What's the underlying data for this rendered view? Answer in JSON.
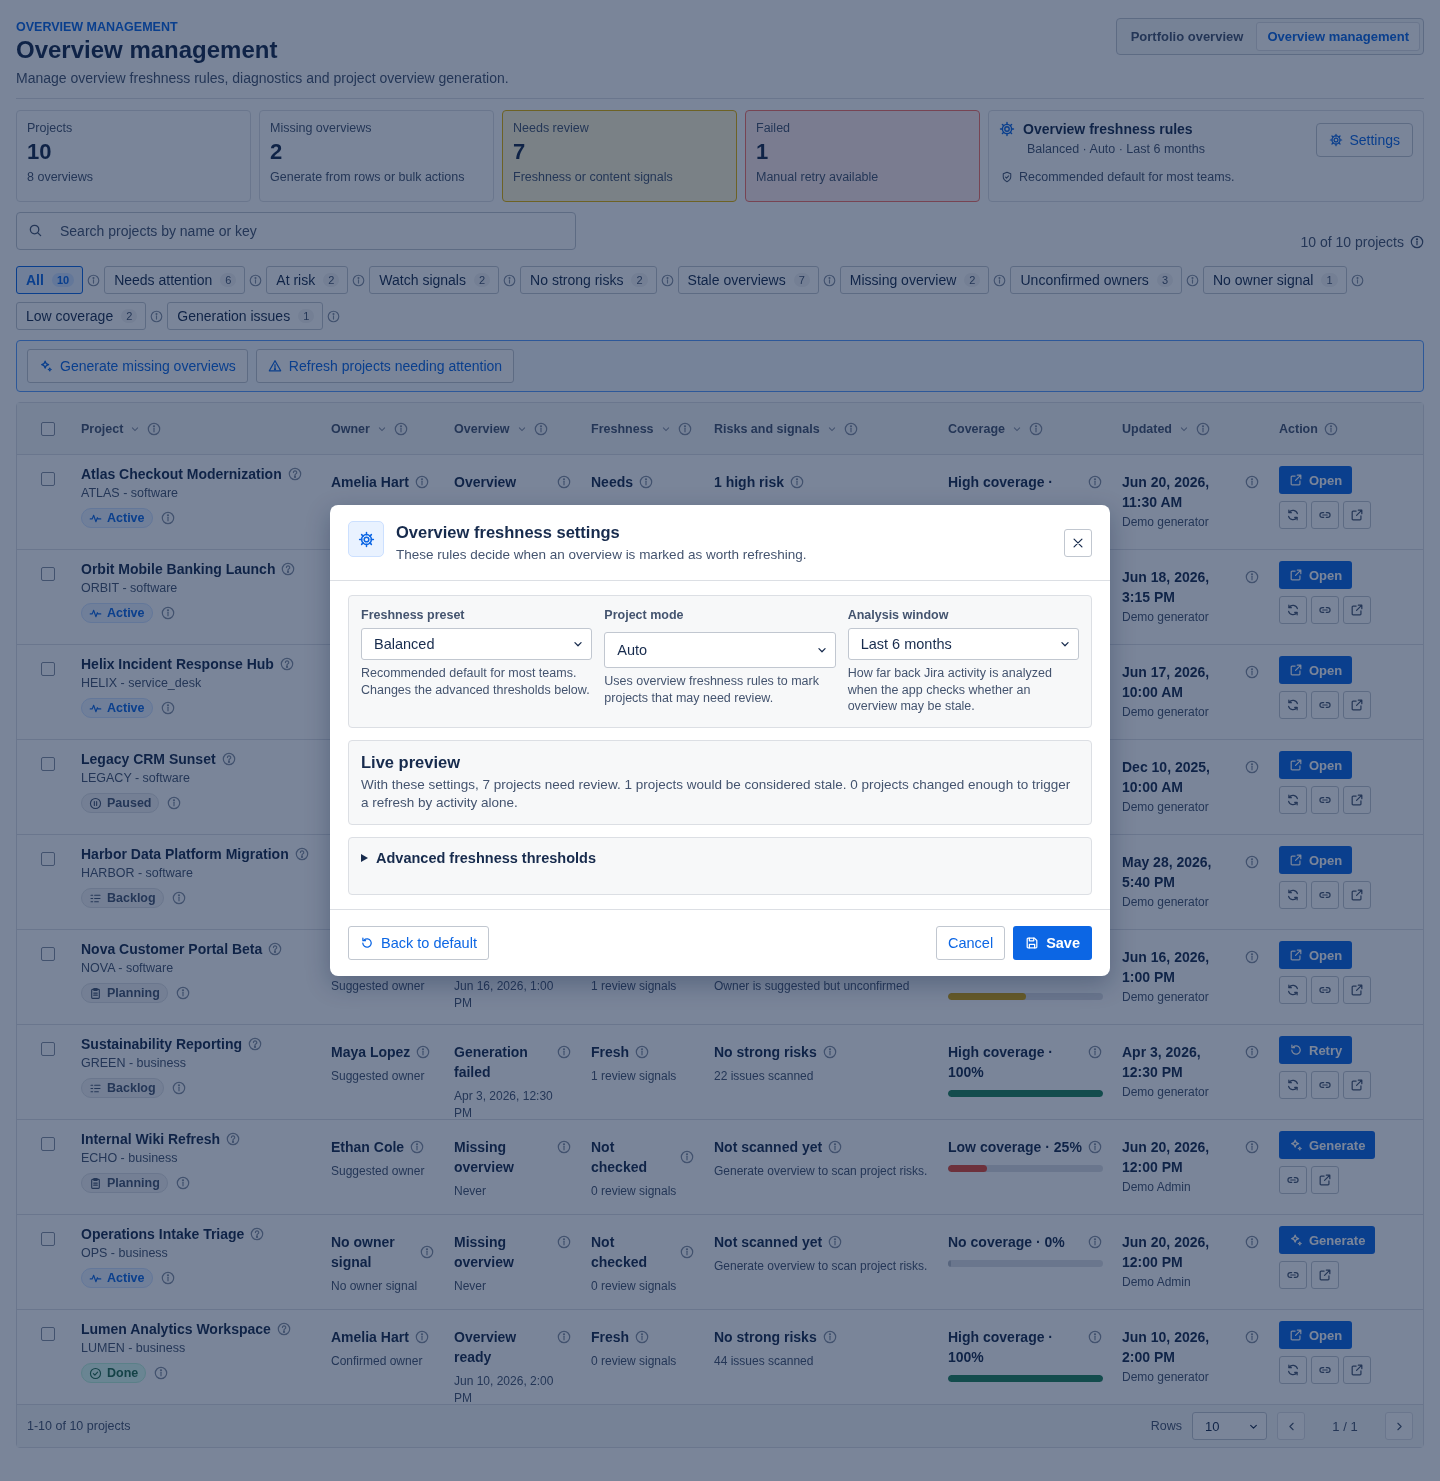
{
  "header": {
    "eyebrow": "OVERVIEW MANAGEMENT",
    "title": "Overview management",
    "subtitle": "Manage overview freshness rules, diagnostics and project overview generation."
  },
  "view_switch": [
    {
      "label": "Portfolio overview",
      "selected": false
    },
    {
      "label": "Overview management",
      "selected": true
    }
  ],
  "stats": [
    {
      "label": "Projects",
      "value": "10",
      "note": "8 overviews",
      "kind": "neutral"
    },
    {
      "label": "Missing overviews",
      "value": "2",
      "note": "Generate from rows or bulk actions",
      "kind": "neutral"
    },
    {
      "label": "Needs review",
      "value": "7",
      "note": "Freshness or content signals",
      "kind": "warning"
    },
    {
      "label": "Failed",
      "value": "1",
      "note": "Manual retry available",
      "kind": "danger"
    }
  ],
  "rules_card": {
    "title": "Overview freshness rules",
    "summary": "Balanced · Auto · Last 6 months",
    "note": "Recommended default for most teams.",
    "button": "Settings"
  },
  "search": {
    "placeholder": "Search projects by name or key"
  },
  "result_count": "10 of 10 projects",
  "filters": [
    {
      "label": "All",
      "count": "10",
      "selected": true
    },
    {
      "label": "Needs attention",
      "count": "6",
      "selected": false
    },
    {
      "label": "At risk",
      "count": "2",
      "selected": false
    },
    {
      "label": "Watch signals",
      "count": "2",
      "selected": false
    },
    {
      "label": "No strong risks",
      "count": "2",
      "selected": false
    },
    {
      "label": "Stale overviews",
      "count": "7",
      "selected": false
    },
    {
      "label": "Missing overview",
      "count": "2",
      "selected": false
    },
    {
      "label": "Unconfirmed owners",
      "count": "3",
      "selected": false
    },
    {
      "label": "No owner signal",
      "count": "1",
      "selected": false
    },
    {
      "label": "Low coverage",
      "count": "2",
      "selected": false
    },
    {
      "label": "Generation issues",
      "count": "1",
      "selected": false
    }
  ],
  "bulk_actions": [
    {
      "kind": "generate",
      "label": "Generate missing overviews"
    },
    {
      "kind": "refresh",
      "label": "Refresh projects needing attention"
    }
  ],
  "table": {
    "select_all": false,
    "columns": [
      {
        "label": "Project",
        "sortable": true
      },
      {
        "label": "Owner",
        "sortable": true
      },
      {
        "label": "Overview",
        "sortable": true
      },
      {
        "label": "Freshness",
        "sortable": true
      },
      {
        "label": "Risks and signals",
        "sortable": true
      },
      {
        "label": "Coverage",
        "sortable": true
      },
      {
        "label": "Updated",
        "sortable": true
      },
      {
        "label": "Action",
        "sortable": false
      }
    ],
    "rows": [
      {
        "selected": false,
        "name": "Atlas Checkout Modernization",
        "key": "ATLAS - software",
        "status": {
          "kind": "active",
          "label": "Active"
        },
        "owner": {
          "title": "Amelia Hart"
        },
        "overview": {
          "title": "Overview"
        },
        "freshness": {
          "title": "Needs"
        },
        "risk": {
          "title": "1 high risk"
        },
        "coverage": {
          "label": "High coverage ·"
        },
        "updated": {
          "date": "Jun 20, 2026, 11:30 AM",
          "by": "Demo generator"
        },
        "action": {
          "kind": "open",
          "label": "Open"
        },
        "tools": [
          {
            "kind": "refresh"
          },
          {
            "kind": "link"
          },
          {
            "kind": "external"
          }
        ]
      },
      {
        "selected": false,
        "name": "Orbit Mobile Banking Launch",
        "key": "ORBIT - software",
        "status": {
          "kind": "active",
          "label": "Active"
        },
        "owner": {},
        "overview": {},
        "freshness": {},
        "risk": {},
        "coverage": {},
        "updated": {
          "date": "Jun 18, 2026, 3:15 PM",
          "by": "Demo generator"
        },
        "action": {
          "kind": "open",
          "label": "Open"
        },
        "tools": [
          {
            "kind": "refresh"
          },
          {
            "kind": "link"
          },
          {
            "kind": "external"
          }
        ]
      },
      {
        "selected": false,
        "name": "Helix Incident Response Hub",
        "key": "HELIX - service_desk",
        "status": {
          "kind": "active",
          "label": "Active"
        },
        "owner": {},
        "overview": {},
        "freshness": {},
        "risk": {},
        "coverage": {},
        "updated": {
          "date": "Jun 17, 2026, 10:00 AM",
          "by": "Demo generator"
        },
        "action": {
          "kind": "open",
          "label": "Open"
        },
        "tools": [
          {
            "kind": "refresh"
          },
          {
            "kind": "link"
          },
          {
            "kind": "external"
          }
        ]
      },
      {
        "selected": false,
        "name": "Legacy CRM Sunset",
        "key": "LEGACY - software",
        "status": {
          "kind": "paused",
          "label": "Paused"
        },
        "owner": {},
        "overview": {},
        "freshness": {},
        "risk": {},
        "coverage": {},
        "updated": {
          "date": "Dec 10, 2025, 10:00 AM",
          "by": "Demo generator"
        },
        "action": {
          "kind": "open",
          "label": "Open"
        },
        "tools": [
          {
            "kind": "refresh"
          },
          {
            "kind": "link"
          },
          {
            "kind": "external"
          }
        ]
      },
      {
        "selected": false,
        "name": "Harbor Data Platform Migration",
        "key": "HARBOR - software",
        "status": {
          "kind": "backlog",
          "label": "Backlog"
        },
        "owner": {},
        "overview": {},
        "freshness": {},
        "risk": {},
        "coverage": {},
        "updated": {
          "date": "May 28, 2026, 5:40 PM",
          "by": "Demo generator"
        },
        "action": {
          "kind": "open",
          "label": "Open"
        },
        "tools": [
          {
            "kind": "refresh"
          },
          {
            "kind": "link"
          },
          {
            "kind": "external"
          }
        ]
      },
      {
        "selected": false,
        "name": "Nova Customer Portal Beta",
        "key": "NOVA - software",
        "status": {
          "kind": "planning",
          "label": "Planning"
        },
        "owner": {
          "note": "Suggested owner"
        },
        "overview": {
          "note": "Jun 16, 2026, 1:00 PM"
        },
        "freshness": {
          "note": "1 review signals"
        },
        "risk": {
          "note": "Owner is suggested but unconfirmed"
        },
        "coverage": {
          "kind": "medium",
          "level": 0.5
        },
        "updated": {
          "date": "Jun 16, 2026, 1:00 PM",
          "by": "Demo generator"
        },
        "action": {
          "kind": "open",
          "label": "Open"
        },
        "tools": [
          {
            "kind": "refresh"
          },
          {
            "kind": "link"
          },
          {
            "kind": "external"
          }
        ]
      },
      {
        "selected": false,
        "name": "Sustainability Reporting",
        "key": "GREEN - business",
        "status": {
          "kind": "backlog",
          "label": "Backlog"
        },
        "owner": {
          "title": "Maya Lopez",
          "note": "Suggested owner"
        },
        "overview": {
          "title": "Generation failed",
          "note": "Apr 3, 2026, 12:30 PM"
        },
        "freshness": {
          "title": "Fresh",
          "note": "1 review signals"
        },
        "risk": {
          "title": "No strong risks",
          "note": "22 issues scanned"
        },
        "coverage": {
          "label": "High coverage · 100%",
          "kind": "high",
          "level": 1
        },
        "updated": {
          "date": "Apr 3, 2026, 12:30 PM",
          "by": "Demo generator"
        },
        "action": {
          "kind": "retry",
          "label": "Retry"
        },
        "tools": [
          {
            "kind": "refresh"
          },
          {
            "kind": "link"
          },
          {
            "kind": "external"
          }
        ]
      },
      {
        "selected": false,
        "name": "Internal Wiki Refresh",
        "key": "ECHO - business",
        "status": {
          "kind": "planning",
          "label": "Planning"
        },
        "owner": {
          "title": "Ethan Cole",
          "note": "Suggested owner"
        },
        "overview": {
          "title": "Missing overview",
          "note": "Never"
        },
        "freshness": {
          "title": "Not checked",
          "note": "0 review signals"
        },
        "risk": {
          "title": "Not scanned yet",
          "note": "Generate overview to scan project risks."
        },
        "coverage": {
          "label": "Low coverage · 25%",
          "kind": "low",
          "level": 0.25
        },
        "updated": {
          "date": "Jun 20, 2026, 12:00 PM",
          "by": "Demo Admin"
        },
        "action": {
          "kind": "generate",
          "label": "Generate"
        },
        "tools": [
          {
            "kind": "link"
          },
          {
            "kind": "external"
          }
        ]
      },
      {
        "selected": false,
        "name": "Operations Intake Triage",
        "key": "OPS - business",
        "status": {
          "kind": "active",
          "label": "Active"
        },
        "owner": {
          "title": "No owner signal",
          "note": "No owner signal"
        },
        "overview": {
          "title": "Missing overview",
          "note": "Never"
        },
        "freshness": {
          "title": "Not checked",
          "note": "0 review signals"
        },
        "risk": {
          "title": "Not scanned yet",
          "note": "Generate overview to scan project risks."
        },
        "coverage": {
          "label": "No coverage · 0%",
          "kind": "none",
          "level": 0
        },
        "updated": {
          "date": "Jun 20, 2026, 12:00 PM",
          "by": "Demo Admin"
        },
        "action": {
          "kind": "generate",
          "label": "Generate"
        },
        "tools": [
          {
            "kind": "link"
          },
          {
            "kind": "external"
          }
        ]
      },
      {
        "selected": false,
        "name": "Lumen Analytics Workspace",
        "key": "LUMEN - business",
        "status": {
          "kind": "done",
          "label": "Done"
        },
        "owner": {
          "title": "Amelia Hart",
          "note": "Confirmed owner"
        },
        "overview": {
          "title": "Overview ready",
          "note": "Jun 10, 2026, 2:00 PM"
        },
        "freshness": {
          "title": "Fresh",
          "note": "0 review signals"
        },
        "risk": {
          "title": "No strong risks",
          "note": "44 issues scanned"
        },
        "coverage": {
          "label": "High coverage · 100%",
          "kind": "high",
          "level": 1
        },
        "updated": {
          "date": "Jun 10, 2026, 2:00 PM",
          "by": "Demo generator"
        },
        "action": {
          "kind": "open",
          "label": "Open"
        },
        "tools": [
          {
            "kind": "refresh"
          },
          {
            "kind": "link"
          },
          {
            "kind": "external"
          }
        ]
      }
    ]
  },
  "pagination": {
    "summary": "1-10 of 10 projects",
    "rows_label": "Rows",
    "rows_value": "10",
    "page": "1 / 1"
  },
  "dialog": {
    "title": "Overview freshness settings",
    "subtitle": "These rules decide when an overview is marked as worth refreshing.",
    "fields": [
      {
        "label": "Freshness preset",
        "value": "Balanced",
        "help": "Recommended default for most teams. Changes the advanced thresholds below."
      },
      {
        "label": "Project mode",
        "value": "Auto",
        "help": "Uses overview freshness rules to mark projects that may need review."
      },
      {
        "label": "Analysis window",
        "value": "Last 6 months",
        "help": "How far back Jira activity is analyzed when the app checks whether an overview may be stale."
      }
    ],
    "preview": {
      "title": "Live preview",
      "text": "With these settings, 7 projects need review. 1 projects would be considered stale. 0 projects changed enough to trigger a refresh by activity alone."
    },
    "advanced": {
      "label": "Advanced freshness thresholds",
      "expanded": false
    },
    "reset_button": "Back to default",
    "cancel_button": "Cancel",
    "save_button": "Save"
  }
}
